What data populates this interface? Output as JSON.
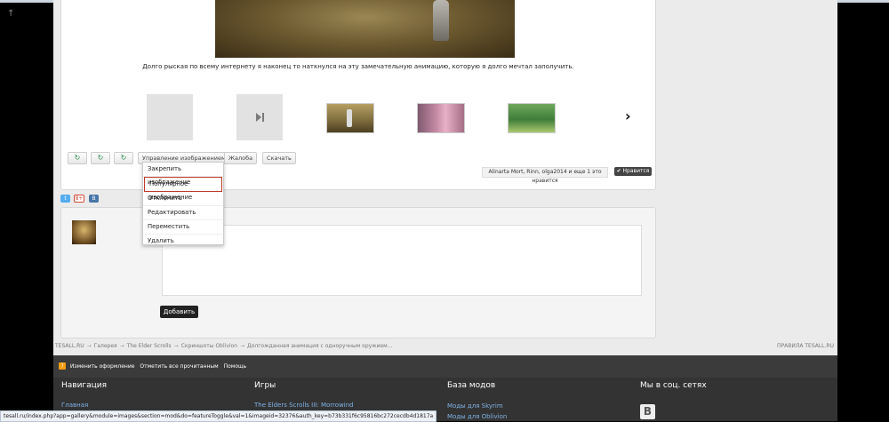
{
  "gallery": {
    "description": "Долго рыская по всему интернету я наконец то наткнулся на эту замечательную анимацию, которую я долго мечтал заполучить.",
    "next_arrow": "›"
  },
  "toolbar": {
    "manage_images": "Управление изображением",
    "report": "Жалоба",
    "download": "Скачать",
    "icon_glyph": "↻"
  },
  "manage_menu": {
    "items": [
      "Закрепить изображение",
      "Популярное изображение",
      "Отклонить",
      "Редактировать",
      "Переместить",
      "Удалить"
    ],
    "highlighted_index": 1
  },
  "likes": {
    "text": "Alinarta Mort, Rinn, olga2014 и еще 1 это нравится",
    "button": "✔ Нравится"
  },
  "share": {
    "twitter": "t",
    "gplus": "8+",
    "vk": "B"
  },
  "comment": {
    "submit_label": "Добавить"
  },
  "breadcrumb": {
    "items": [
      "TESALL.RU",
      "Галерея",
      "The Elder Scrolls",
      "Скриншоты Oblivion",
      "Долгожданная анимация с одноручным оружием..."
    ],
    "rules": "ПРАВИЛА TESALL.RU",
    "separator": "→"
  },
  "footer": {
    "links": [
      "Изменить оформление",
      "Отметить все прочитанным",
      "Помощь"
    ],
    "columns": [
      {
        "title": "Навигация",
        "links": [
          "Главная"
        ]
      },
      {
        "title": "Игры",
        "links": [
          "The Elders Scrolls III: Morrowind"
        ]
      },
      {
        "title": "База модов",
        "links": [
          "Моды для Skyrim",
          "Моды для Oblivion"
        ]
      },
      {
        "title": "Мы в соц. сетях",
        "links": []
      }
    ],
    "vk_glyph": "B"
  },
  "status_bar": {
    "url": "tesall.ru/index.php?app=gallery&module=images&section=mod&do=featureToggle&val=1&imageid=32376&auth_key=b73b331f6c95816bc272cecdb4d1817a"
  },
  "scroll_up_glyph": "↑"
}
